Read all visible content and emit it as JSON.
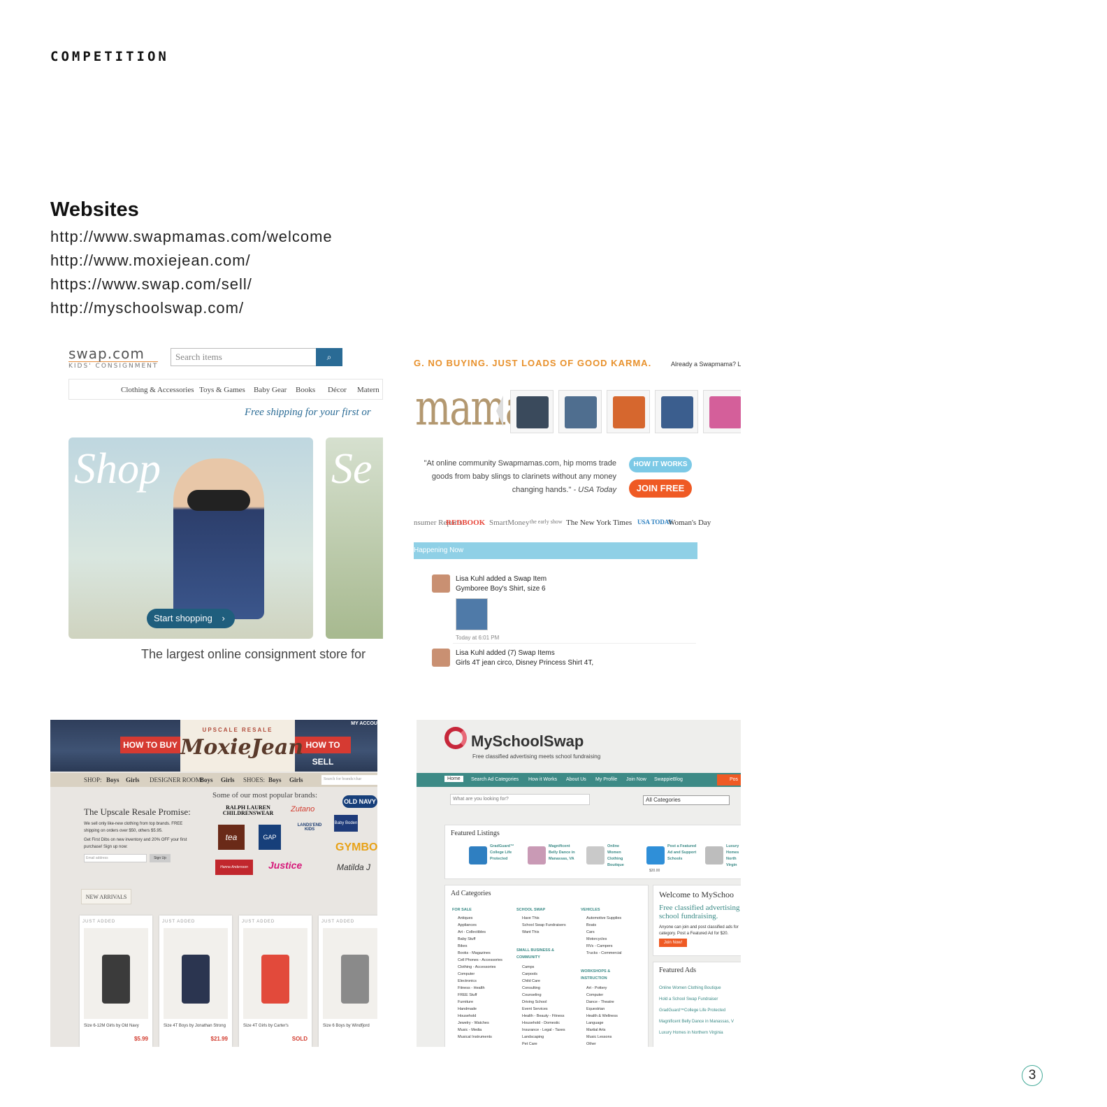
{
  "page": {
    "section_label": "COMPETITION",
    "heading": "Websites",
    "urls": [
      "http://www.swapmamas.com/welcome",
      "http://www.moxiejean.com/",
      "https://www.swap.com/sell/",
      "http://myschoolswap.com/"
    ],
    "page_number": "3"
  },
  "swap": {
    "logo": "swap.com",
    "logo_sub": "KIDS' CONSIGNMENT",
    "search_placeholder": "Search items",
    "search_icon": "magnifier-icon",
    "nav": [
      "Clothing & Accessories",
      "Toys & Games",
      "Baby Gear",
      "Books",
      "Décor",
      "Matern"
    ],
    "shipping": "Free shipping for your first or",
    "hero_word": "Shop",
    "hero_word_2": "Se",
    "start_button": "Start shopping",
    "chevron_icon": "chevron-right-icon",
    "tagline": "The largest online consignment store for"
  },
  "mamas": {
    "tagline": "G. NO BUYING. JUST LOADS OF GOOD KARMA.",
    "login_prompt": "Already a Swapmama? Lo",
    "logo": "mamas",
    "thumb_colors": [
      "#3a4a5c",
      "#4f6e8f",
      "#d6672e",
      "#3b5e8e",
      "#d45f9a"
    ],
    "quote": "\"At online community Swapmamas.com, hip moms trade goods from baby slings to clarinets without any money changing hands.\"",
    "quote_source": "- USA Today",
    "how_button": "HOW IT WORKS",
    "join_button": "JOIN FREE",
    "press": [
      "nsumer Reports",
      "REDBOOK",
      "SmartMoney",
      "the early show",
      "The New York Times",
      "USA TODAY",
      "Woman's Day"
    ],
    "happening": "Happening Now",
    "activity_1_line1": "Lisa Kuhl added a Swap Item",
    "activity_1_line2": "Gymboree Boy's Shirt, size 6",
    "activity_1_time": "Today at 6:01 PM",
    "activity_2_line1": "Lisa Kuhl added (7) Swap Items",
    "activity_2_line2": "Girls 4T jean circo, Disney Princess Shirt 4T,"
  },
  "moxie": {
    "account": "MY ACCOU",
    "logo_sub": "UPSCALE RESALE",
    "logo": "MoxieJean",
    "buy_ribbon": "HOW TO BUY",
    "sell_ribbon": "HOW TO SELL",
    "nav": [
      "SHOP:",
      "Boys",
      "Girls",
      "DESIGNER ROOM:",
      "Boys",
      "Girls",
      "SHOES:",
      "Boys",
      "Girls"
    ],
    "nav_search": "Search for brands/char",
    "promise_title": "The Upscale Resale Promise:",
    "promise_text": "We sell only like-new clothing from top brands. FREE shipping on orders over $50, others $5.95.",
    "first_dibs": "Get First Dibs on new inventory and 20% OFF your first purchase! Sign up now:",
    "email_placeholder": "Email address",
    "signup": "Sign Up",
    "brands_heading": "Some of our most popular brands:",
    "brands": [
      "RALPH LAUREN CHILDRENSWEAR",
      "Zutano",
      "OLD NAVY",
      "tea",
      "GAP",
      "LANDS'END KIDS",
      "Baby Boden",
      "GYMBORE",
      "Hanna Andersson",
      "Justice",
      "Matilda J"
    ],
    "new_arrivals": "NEW ARRIVALS",
    "cards": [
      {
        "just": "JUST ADDED",
        "caption": "Size 6-12M Girls by Old Navy",
        "price": "$5.99",
        "color": "#3b3b3b"
      },
      {
        "just": "JUST ADDED",
        "caption": "Size 4T Boys by Jonathan Strong",
        "price": "$21.99",
        "color": "#2b3550"
      },
      {
        "just": "JUST ADDED",
        "caption": "Size 4T Girls by Carter's",
        "price": "SOLD",
        "color": "#e24a3b"
      },
      {
        "just": "JUST ADDED",
        "caption": "Size 6 Boys by Windfjord",
        "price": "$",
        "color": "#8a8a8a"
      }
    ]
  },
  "mss": {
    "logo": "MySchoolSwap",
    "sub": "Free classified advertising meets school fundraising",
    "nav": [
      "Home",
      "Search Ad Categories",
      "How it Works",
      "About Us",
      "My Profile",
      "Join Now",
      "SwappieBlog"
    ],
    "post": "Pos",
    "search_placeholder": "What are you looking for?",
    "category_select": "All Categories",
    "featured_title": "Featured Listings",
    "featured": [
      {
        "text": "GradGuard™ College Life Protected",
        "color": "#2f7fc1"
      },
      {
        "text": "Magnificent Belly Dance in Manassas, VA",
        "color": "#c99ab5"
      },
      {
        "text": "Online Women Clothing Boutique",
        "color": "#c9c9c9"
      },
      {
        "text": "Post a Featured Ad and Support Schools",
        "color": "#2f8fd8"
      },
      {
        "text": "Luxury Homes North Virgin",
        "color": "#bdbdbd"
      }
    ],
    "featured_price": "$20.00",
    "ad_categories_title": "Ad Categories",
    "col1_head": "FOR SALE",
    "col1": [
      "Antiques",
      "Appliances",
      "Art - Collectibles",
      "Baby Stuff",
      "Bikes",
      "Books - Magazines",
      "Cell Phones - Accessories",
      "Clothing - Accessories",
      "Computer",
      "Electronics",
      "Fitness - Health",
      "FREE Stuff",
      "Furniture",
      "Handmade",
      "Household",
      "Jewelry - Watches",
      "Music - Media",
      "Musical Instruments"
    ],
    "col2_head": "SCHOOL SWAP",
    "col2": [
      "Have This",
      "School Swap Fundraisers",
      "Want This"
    ],
    "col2b_head": "SMALL BUSINESS & COMMUNITY",
    "col2b": [
      "Camps",
      "Carpools",
      "Child Care",
      "Consulting",
      "Counseling",
      "Driving School",
      "Event Services",
      "Health - Beauty - Fitness",
      "Household - Domestic",
      "Insurance - Legal - Taxes",
      "Landscaping",
      "Pet Care"
    ],
    "col3_head": "VEHICLES",
    "col3": [
      "Automotive Supplies",
      "Boats",
      "Cars",
      "Motorcycles",
      "RVs - Campers",
      "Trucks - Commercial"
    ],
    "col3b_head": "WORKSHOPS & INSTRUCTION",
    "col3b": [
      "Art - Pottery",
      "Computer",
      "Dance - Theatre",
      "Equestrian",
      "Health & Wellness",
      "Language",
      "Martial Arts",
      "Music Lessons",
      "Other"
    ],
    "welcome": "Welcome to MySchoo",
    "free_text": "Free classified advertising school fundraising.",
    "anyone": "Anyone can join and post classified ads for category. Post a Featured Ad for $20.",
    "join_now": "Join Now!",
    "featured_ads_title": "Featured Ads",
    "featured_ads": [
      "Online Women Clothing Boutique",
      "Hold a School Swap Fundraiser",
      "GradGuard™College Life Protected",
      "Magnificent Belly Dance in Manassas, V",
      "Luxury Homes in Northern Virginia"
    ]
  }
}
